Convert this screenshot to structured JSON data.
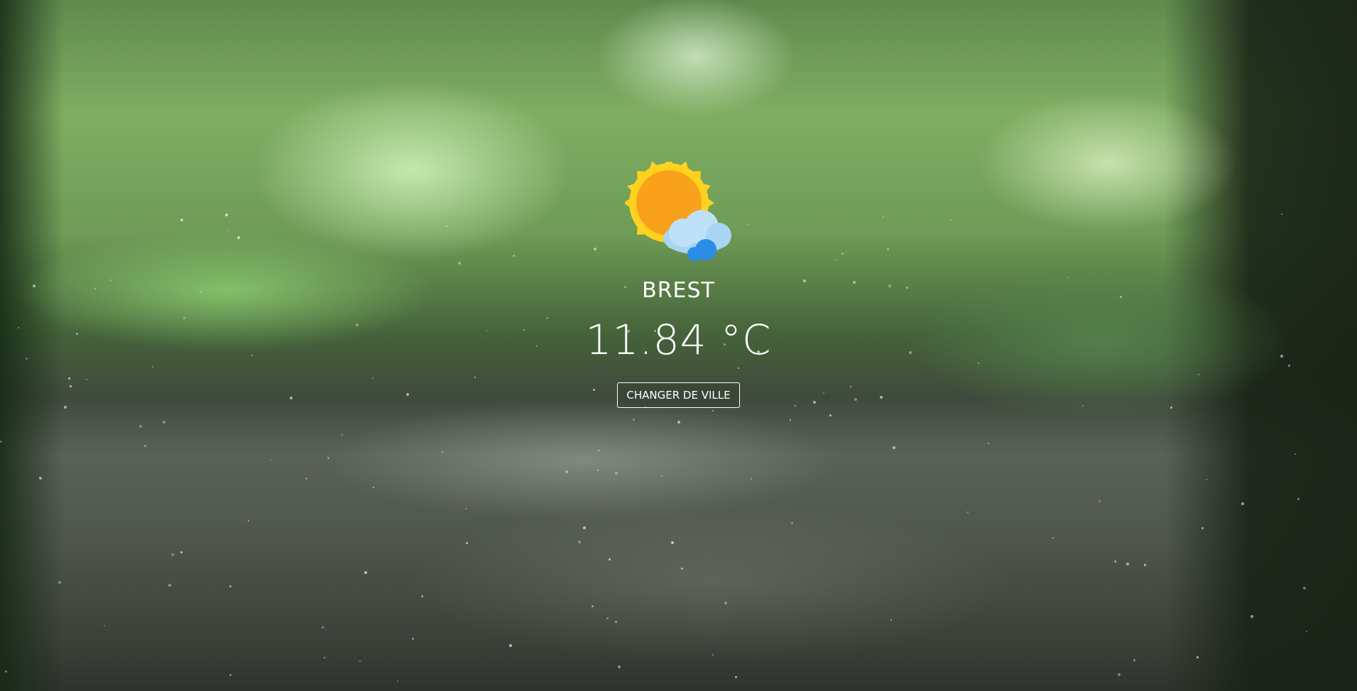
{
  "weather": {
    "icon": "sun-behind-cloud-icon",
    "city": "BREST",
    "temperature": "11.84 °C"
  },
  "actions": {
    "change_city_label": "CHANGER DE VILLE"
  },
  "colors": {
    "sun_core": "#f9a11b",
    "sun_rays": "#ffd21f",
    "cloud": "#a9d5f5",
    "cloud_dark": "#2b8de6",
    "text": "#ffffff"
  }
}
